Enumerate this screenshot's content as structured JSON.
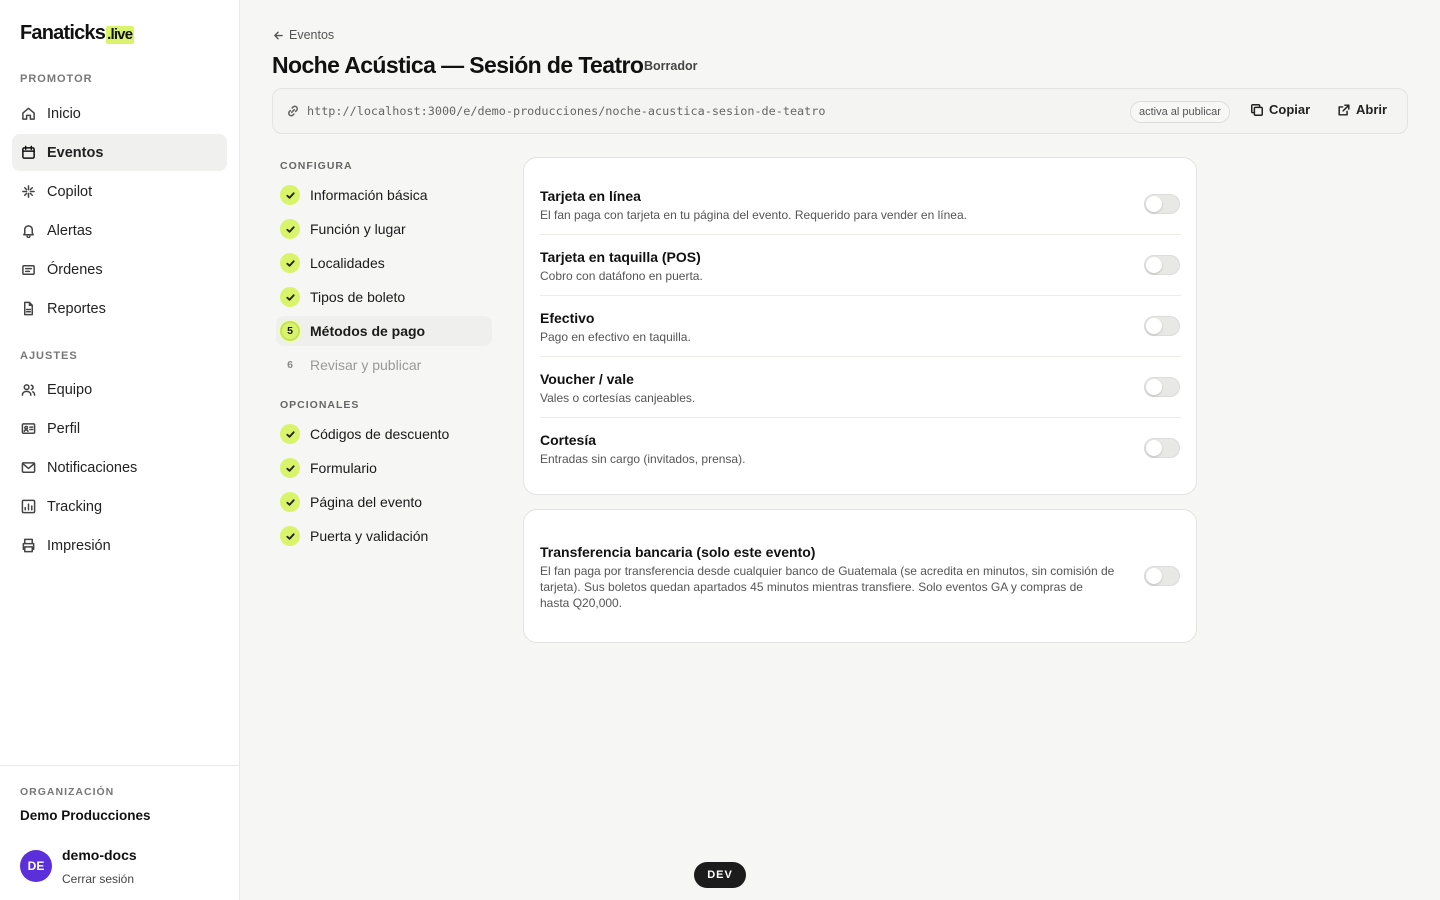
{
  "brand": {
    "name": "Fanaticks",
    "tld": ".live",
    "accent": "#d9f36a"
  },
  "sidebar": {
    "section_promotor": "PROMOTOR",
    "promotor_items": [
      {
        "label": "Inicio",
        "icon": "home-icon",
        "active": false
      },
      {
        "label": "Eventos",
        "icon": "calendar-icon",
        "active": true
      },
      {
        "label": "Copilot",
        "icon": "sparkle-icon",
        "active": false
      },
      {
        "label": "Alertas",
        "icon": "bell-icon",
        "active": false
      },
      {
        "label": "Órdenes",
        "icon": "ticket-icon",
        "active": false
      },
      {
        "label": "Reportes",
        "icon": "file-icon",
        "active": false
      }
    ],
    "section_ajustes": "AJUSTES",
    "ajustes_items": [
      {
        "label": "Equipo",
        "icon": "users-icon"
      },
      {
        "label": "Perfil",
        "icon": "id-card-icon"
      },
      {
        "label": "Notificaciones",
        "icon": "mail-icon"
      },
      {
        "label": "Tracking",
        "icon": "chart-icon"
      },
      {
        "label": "Impresión",
        "icon": "printer-icon"
      }
    ],
    "org_label": "ORGANIZACIÓN",
    "org_name": "Demo Producciones",
    "user": {
      "initials": "DE",
      "name": "demo-docs",
      "logout": "Cerrar sesión",
      "avatar_color": "#5b2fd9"
    }
  },
  "header": {
    "back_label": "Eventos",
    "title": "Noche Acústica — Sesión de Teatro",
    "status": "Borrador",
    "url": "http://localhost:3000/e/demo-producciones/noche-acustica-sesion-de-teatro",
    "url_badge": "activa al publicar",
    "copy_label": "Copiar",
    "open_label": "Abrir"
  },
  "steps": {
    "configura_label": "CONFIGURA",
    "configura": [
      {
        "label": "Información básica",
        "state": "done"
      },
      {
        "label": "Función y lugar",
        "state": "done"
      },
      {
        "label": "Localidades",
        "state": "done"
      },
      {
        "label": "Tipos de boleto",
        "state": "done"
      },
      {
        "label": "Métodos de pago",
        "state": "current",
        "number": "5"
      },
      {
        "label": "Revisar y publicar",
        "state": "pending",
        "number": "6"
      }
    ],
    "opcionales_label": "OPCIONALES",
    "opcionales": [
      {
        "label": "Códigos de descuento",
        "state": "done"
      },
      {
        "label": "Formulario",
        "state": "done"
      },
      {
        "label": "Página del evento",
        "state": "done"
      },
      {
        "label": "Puerta y validación",
        "state": "done"
      }
    ]
  },
  "payment_methods": [
    {
      "title": "Tarjeta en línea",
      "desc": "El fan paga con tarjeta en tu página del evento. Requerido para vender en línea.",
      "enabled": false
    },
    {
      "title": "Tarjeta en taquilla (POS)",
      "desc": "Cobro con datáfono en puerta.",
      "enabled": false
    },
    {
      "title": "Efectivo",
      "desc": "Pago en efectivo en taquilla.",
      "enabled": false
    },
    {
      "title": "Voucher / vale",
      "desc": "Vales o cortesías canjeables.",
      "enabled": false
    },
    {
      "title": "Cortesía",
      "desc": "Entradas sin cargo (invitados, prensa).",
      "enabled": false
    }
  ],
  "bank_transfer": {
    "title": "Transferencia bancaria (solo este evento)",
    "desc": "El fan paga por transferencia desde cualquier banco de Guatemala (se acredita en minutos, sin comisión de tarjeta). Sus boletos quedan apartados 45 minutos mientras transfiere. Solo eventos GA y compras de hasta Q20,000.",
    "enabled": false
  },
  "env_badge": "DEV"
}
